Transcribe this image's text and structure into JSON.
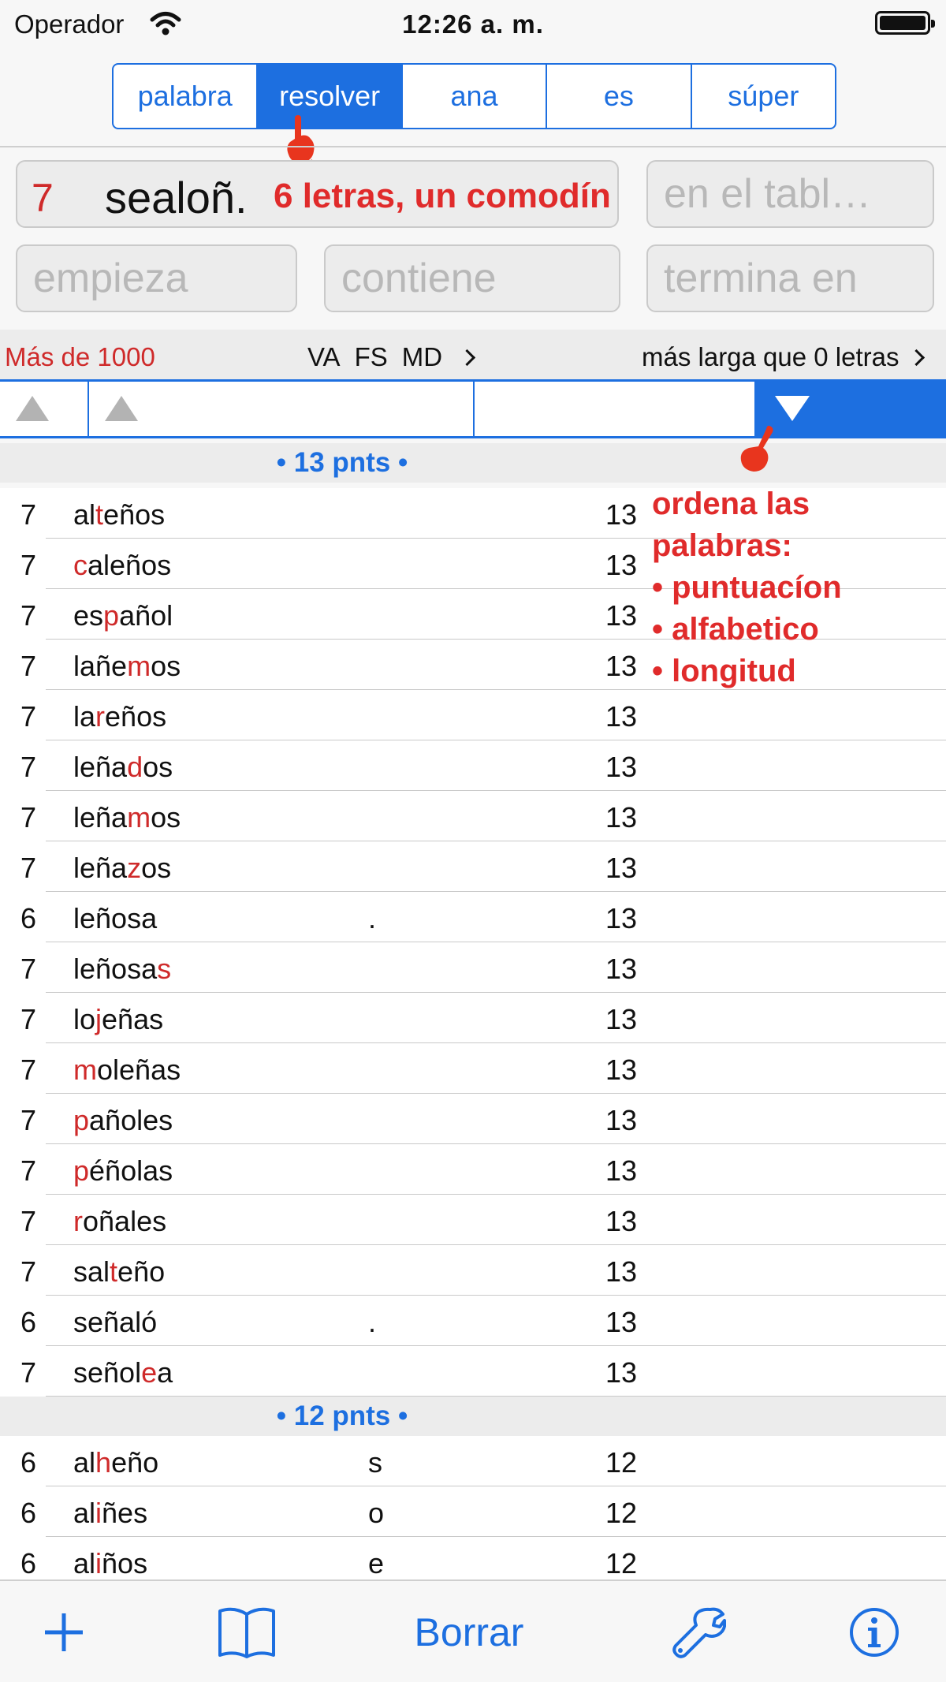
{
  "status_bar": {
    "carrier": "Operador",
    "time": "12:26 a. m."
  },
  "segments": [
    {
      "label": "palabra",
      "active": false
    },
    {
      "label": "resolver",
      "active": true
    },
    {
      "label": "ana",
      "active": false
    },
    {
      "label": "es",
      "active": false
    },
    {
      "label": "súper",
      "active": false
    }
  ],
  "inputs": {
    "letters_count": "7",
    "letters_value": "sealoñ.",
    "board_placeholder": "en el tabl…",
    "starts_placeholder": "empieza",
    "contains_placeholder": "contiene",
    "ends_placeholder": "termina en"
  },
  "annotations": {
    "wildcard_note": "6 letras, un comodín",
    "sort_note_title": "ordena las palabras:",
    "sort_note_items": [
      "• puntuacíon",
      "• alfabetico",
      "• longitud"
    ]
  },
  "options": {
    "result_count": "Más de 1000",
    "flags": [
      "VA",
      "FS",
      "MD"
    ],
    "min_length": "más larga que 0 letras"
  },
  "sections": [
    {
      "header": "• 13 pnts •",
      "rows": [
        {
          "len": "7",
          "word": [
            [
              "al",
              ""
            ],
            [
              "t",
              "hl"
            ],
            [
              "eños",
              ""
            ]
          ],
          "blank": "",
          "pts": "13"
        },
        {
          "len": "7",
          "word": [
            [
              "c",
              "hl"
            ],
            [
              "aleños",
              ""
            ]
          ],
          "blank": "",
          "pts": "13"
        },
        {
          "len": "7",
          "word": [
            [
              "es",
              ""
            ],
            [
              "p",
              "hl"
            ],
            [
              "añol",
              ""
            ]
          ],
          "blank": "",
          "pts": "13"
        },
        {
          "len": "7",
          "word": [
            [
              "lañe",
              ""
            ],
            [
              "m",
              "hl"
            ],
            [
              "os",
              ""
            ]
          ],
          "blank": "",
          "pts": "13"
        },
        {
          "len": "7",
          "word": [
            [
              "la",
              ""
            ],
            [
              "r",
              "hl"
            ],
            [
              "eños",
              ""
            ]
          ],
          "blank": "",
          "pts": "13"
        },
        {
          "len": "7",
          "word": [
            [
              "leña",
              ""
            ],
            [
              "d",
              "hl"
            ],
            [
              "os",
              ""
            ]
          ],
          "blank": "",
          "pts": "13"
        },
        {
          "len": "7",
          "word": [
            [
              "leña",
              ""
            ],
            [
              "m",
              "hl"
            ],
            [
              "os",
              ""
            ]
          ],
          "blank": "",
          "pts": "13"
        },
        {
          "len": "7",
          "word": [
            [
              "leña",
              ""
            ],
            [
              "z",
              "hl"
            ],
            [
              "os",
              ""
            ]
          ],
          "blank": "",
          "pts": "13"
        },
        {
          "len": "6",
          "word": [
            [
              "leñosa",
              ""
            ]
          ],
          "blank": ".",
          "pts": "13"
        },
        {
          "len": "7",
          "word": [
            [
              "leñosa",
              ""
            ],
            [
              "s",
              "hl"
            ]
          ],
          "blank": "",
          "pts": "13"
        },
        {
          "len": "7",
          "word": [
            [
              "lo",
              ""
            ],
            [
              "j",
              "hl"
            ],
            [
              "eñas",
              ""
            ]
          ],
          "blank": "",
          "pts": "13"
        },
        {
          "len": "7",
          "word": [
            [
              "m",
              "hl"
            ],
            [
              "oleñas",
              ""
            ]
          ],
          "blank": "",
          "pts": "13"
        },
        {
          "len": "7",
          "word": [
            [
              "p",
              "hl"
            ],
            [
              "añoles",
              ""
            ]
          ],
          "blank": "",
          "pts": "13"
        },
        {
          "len": "7",
          "word": [
            [
              "p",
              "hl"
            ],
            [
              "éñolas",
              ""
            ]
          ],
          "blank": "",
          "pts": "13"
        },
        {
          "len": "7",
          "word": [
            [
              "r",
              "hl"
            ],
            [
              "oñales",
              ""
            ]
          ],
          "blank": "",
          "pts": "13"
        },
        {
          "len": "7",
          "word": [
            [
              "sal",
              ""
            ],
            [
              "t",
              "hl"
            ],
            [
              "eño",
              ""
            ]
          ],
          "blank": "",
          "pts": "13"
        },
        {
          "len": "6",
          "word": [
            [
              "señaló",
              ""
            ]
          ],
          "blank": ".",
          "pts": "13"
        },
        {
          "len": "7",
          "word": [
            [
              "señol",
              ""
            ],
            [
              "e",
              "hl"
            ],
            [
              "a",
              ""
            ]
          ],
          "blank": "",
          "pts": "13"
        }
      ]
    },
    {
      "header": "• 12 pnts •",
      "rows": [
        {
          "len": "6",
          "word": [
            [
              "al",
              ""
            ],
            [
              "h",
              "hl"
            ],
            [
              "eño",
              ""
            ]
          ],
          "blank": "s",
          "pts": "12"
        },
        {
          "len": "6",
          "word": [
            [
              "al",
              ""
            ],
            [
              "i",
              "hl"
            ],
            [
              "ñes",
              ""
            ]
          ],
          "blank": "o",
          "pts": "12"
        },
        {
          "len": "6",
          "word": [
            [
              "al",
              ""
            ],
            [
              "i",
              "hl"
            ],
            [
              "ños",
              ""
            ]
          ],
          "blank": "e",
          "pts": "12"
        }
      ]
    }
  ],
  "toolbar": {
    "add_icon": "plus-icon",
    "dictionary_icon": "book-icon",
    "clear_label": "Borrar",
    "settings_icon": "wrench-icon",
    "info_icon": "info-icon"
  },
  "colors": {
    "accent": "#1d6fe0",
    "highlight": "#cf2a2a",
    "annotation": "#e02b2b"
  }
}
